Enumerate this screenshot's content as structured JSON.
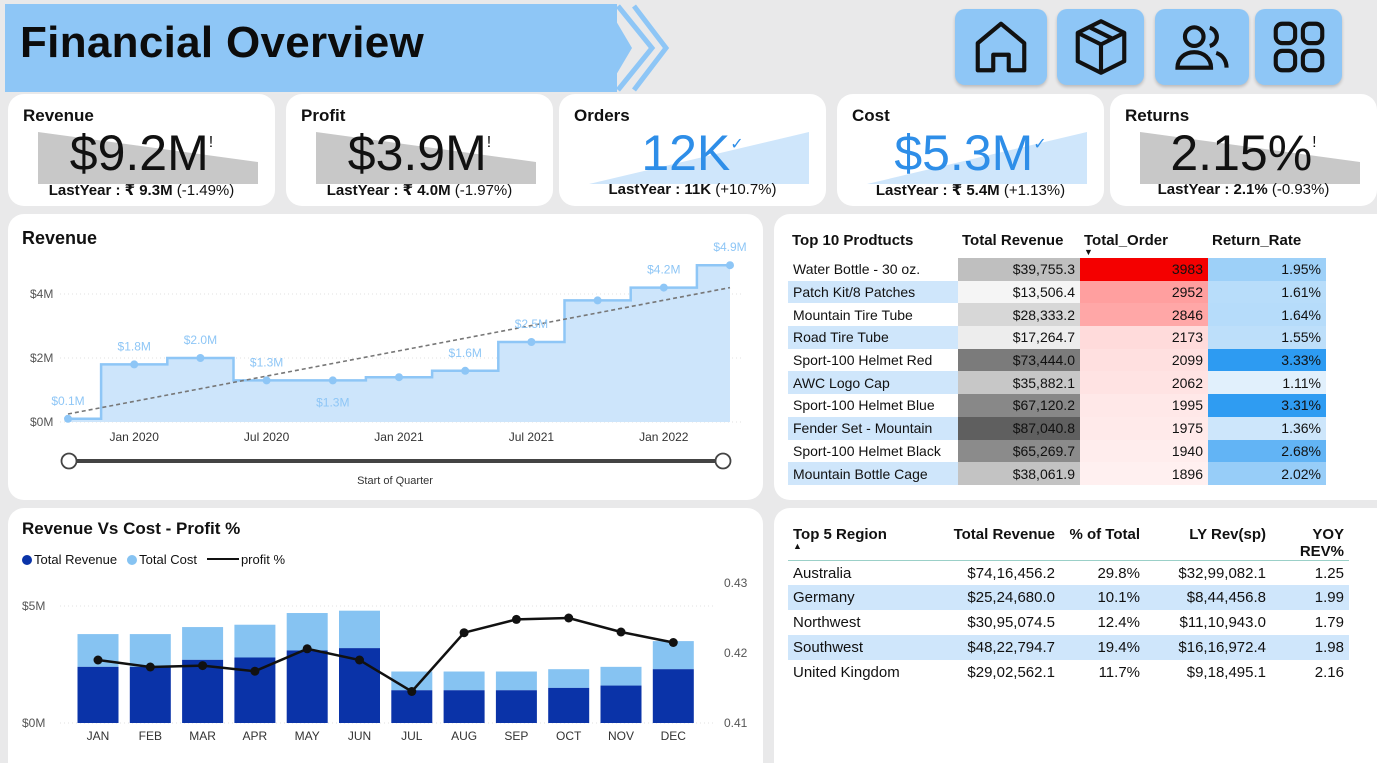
{
  "header": {
    "title": "Financial Overview"
  },
  "nav": [
    {
      "icon": "home-icon"
    },
    {
      "icon": "box-icon"
    },
    {
      "icon": "users-icon"
    },
    {
      "icon": "grid-icon"
    }
  ],
  "kpis": [
    {
      "label": "Revenue",
      "value": "$9.2M",
      "mark": "!",
      "ly_label": "LastYear : ₹ 9.3M",
      "ly_change": "(-1.49%)",
      "color": "#111111",
      "trend": "down"
    },
    {
      "label": "Profit",
      "value": "$3.9M",
      "mark": "!",
      "ly_label": "LastYear : ₹ 4.0M",
      "ly_change": "(-1.97%)",
      "color": "#111111",
      "trend": "down"
    },
    {
      "label": "Orders",
      "value": "12K",
      "mark": "✓",
      "ly_label": "LastYear : 11K",
      "ly_change": "(+10.7%)",
      "color": "#2e8ee8",
      "trend": "up"
    },
    {
      "label": "Cost",
      "value": "$5.3M",
      "mark": "✓",
      "ly_label": "LastYear : ₹ 5.4M",
      "ly_change": "(+1.13%)",
      "color": "#2e8ee8",
      "trend": "up"
    },
    {
      "label": "Returns",
      "value": "2.15%",
      "mark": "!",
      "ly_label": "LastYear : 2.1%",
      "ly_change": "(-0.93%)",
      "color": "#111111",
      "trend": "down"
    }
  ],
  "revenue_chart": {
    "title": "Revenue",
    "slider_label": "Start of Quarter",
    "chart_data": {
      "type": "area",
      "x": [
        "Oct 2019",
        "Jan 2020",
        "Apr 2020",
        "Jul 2020",
        "Oct 2020",
        "Jan 2021",
        "Apr 2021",
        "Jul 2021",
        "Oct 2021",
        "Jan 2022",
        "Apr 2022"
      ],
      "values": [
        0.1,
        1.8,
        2.0,
        1.3,
        1.3,
        1.4,
        1.6,
        2.5,
        3.8,
        4.2,
        4.9
      ],
      "data_labels": [
        "$0.1M",
        "$1.8M",
        "$2.0M",
        "$1.3M",
        "$1.3M",
        "",
        "$1.6M",
        "$2.5M",
        "",
        "$4.2M",
        "$4.9M"
      ],
      "x_ticks": [
        "Jan 2020",
        "Jul 2020",
        "Jan 2021",
        "Jul 2021",
        "Jan 2022"
      ],
      "y_ticks": [
        "$0M",
        "$2M",
        "$4M"
      ],
      "ylim": [
        0,
        5
      ],
      "trendline": true
    }
  },
  "top10": {
    "headers": [
      "Top 10 Prodtucts",
      "Total Revenue",
      "Total_Order",
      "Return_Rate"
    ],
    "rows": [
      [
        "Water Bottle - 30 oz.",
        "$39,755.3",
        "3983",
        "1.95%"
      ],
      [
        "Patch Kit/8 Patches",
        "$13,506.4",
        "2952",
        "1.61%"
      ],
      [
        "Mountain Tire Tube",
        "$28,333.2",
        "2846",
        "1.64%"
      ],
      [
        "Road Tire Tube",
        "$17,264.7",
        "2173",
        "1.55%"
      ],
      [
        "Sport-100 Helmet Red",
        "$73,444.0",
        "2099",
        "3.33%"
      ],
      [
        "AWC Logo Cap",
        "$35,882.1",
        "2062",
        "1.11%"
      ],
      [
        "Sport-100 Helmet Blue",
        "$67,120.2",
        "1995",
        "3.31%"
      ],
      [
        "Fender Set - Mountain",
        "$87,040.8",
        "1975",
        "1.36%"
      ],
      [
        "Sport-100 Helmet Black",
        "$65,269.7",
        "1940",
        "2.68%"
      ],
      [
        "Mountain Bottle Cage",
        "$38,061.9",
        "1896",
        "2.02%"
      ]
    ]
  },
  "combo_chart": {
    "title": "Revenue Vs Cost - Profit %",
    "legend": [
      "Total Revenue",
      "Total Cost",
      "profit %"
    ],
    "chart_data": {
      "type": "bar",
      "categories": [
        "JAN",
        "FEB",
        "MAR",
        "APR",
        "MAY",
        "JUN",
        "JUL",
        "AUG",
        "SEP",
        "OCT",
        "NOV",
        "DEC"
      ],
      "series": [
        {
          "name": "Total Revenue",
          "values": [
            2.4,
            2.4,
            2.7,
            2.8,
            3.1,
            3.2,
            1.4,
            1.4,
            1.4,
            1.5,
            1.6,
            2.3
          ]
        },
        {
          "name": "Total Cost",
          "values": [
            1.4,
            1.4,
            1.4,
            1.4,
            1.6,
            1.6,
            0.8,
            0.8,
            0.8,
            0.8,
            0.8,
            1.2
          ]
        },
        {
          "name": "profit %",
          "values": [
            0.419,
            0.418,
            0.4182,
            0.4174,
            0.4206,
            0.419,
            0.4145,
            0.4229,
            0.4248,
            0.425,
            0.423,
            0.4215
          ]
        }
      ],
      "y_ticks": [
        "$0M",
        "$5M"
      ],
      "y2_ticks": [
        "0.41",
        "0.42",
        "0.43"
      ],
      "ylim": [
        0,
        5
      ],
      "y2lim": [
        0.41,
        0.43
      ]
    }
  },
  "top5": {
    "headers": [
      "Top 5 Region",
      "Total Revenue",
      "% of Total",
      "LY Rev(sp)",
      "YOY REV%"
    ],
    "rows": [
      [
        "Australia",
        "$74,16,456.2",
        "29.8%",
        "$32,99,082.1",
        "1.25"
      ],
      [
        "Germany",
        "$25,24,680.0",
        "10.1%",
        "$8,44,456.8",
        "1.99"
      ],
      [
        "Northwest",
        "$30,95,074.5",
        "12.4%",
        "$11,10,943.0",
        "1.79"
      ],
      [
        "Southwest",
        "$48,22,794.7",
        "19.4%",
        "$16,16,972.4",
        "1.98"
      ],
      [
        "United Kingdom",
        "$29,02,562.1",
        "11.7%",
        "$9,18,495.1",
        "2.16"
      ]
    ]
  }
}
